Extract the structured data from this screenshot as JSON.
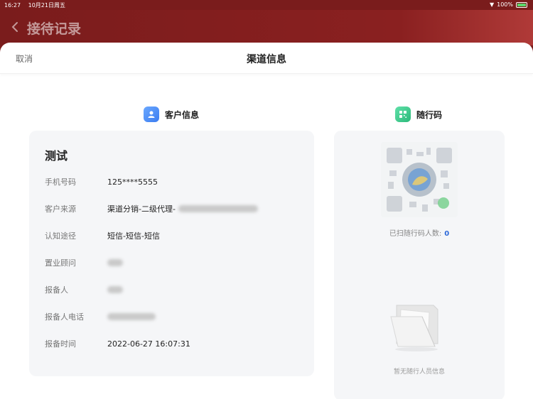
{
  "status_bar": {
    "time": "16:27",
    "date": "10月21日周五",
    "battery": "100%"
  },
  "background_page": {
    "title": "接待记录"
  },
  "sheet": {
    "cancel_label": "取消",
    "title": "渠道信息"
  },
  "customer_section": {
    "title": "客户信息",
    "name": "测试",
    "fields": [
      {
        "label": "手机号码",
        "value": "125****5555"
      },
      {
        "label": "客户来源",
        "value": "渠道分销-二级代理-"
      },
      {
        "label": "认知途径",
        "value": "短信-短信-短信"
      },
      {
        "label": "置业顾问",
        "value": ""
      },
      {
        "label": "报备人",
        "value": ""
      },
      {
        "label": "报备人电话",
        "value": ""
      },
      {
        "label": "报备时间",
        "value": "2022-06-27 16:07:31"
      }
    ]
  },
  "qr_section": {
    "title": "随行码",
    "scan_label": "已扫随行码人数:",
    "scan_count": "0",
    "empty_text": "暂无随行人员信息"
  },
  "colors": {
    "header_red": "#7a1c1c",
    "accent_blue": "#2f6bd9",
    "card_bg": "#f5f6f8"
  }
}
